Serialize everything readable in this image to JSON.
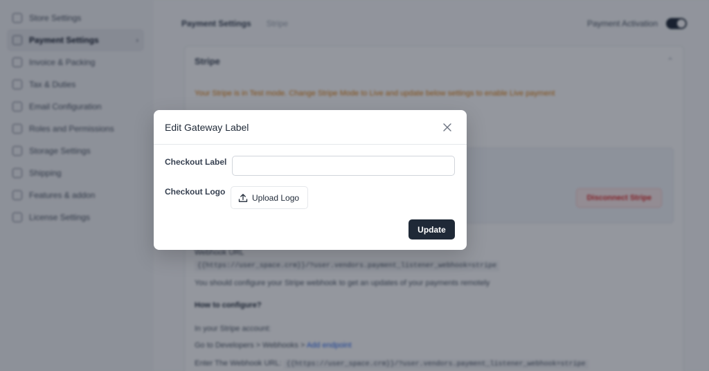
{
  "sidebar": {
    "items": [
      {
        "label": "Store Settings",
        "icon": "store-icon"
      },
      {
        "label": "Payment Settings",
        "icon": "payment-icon",
        "active": true
      },
      {
        "label": "Invoice & Packing",
        "icon": "invoice-icon"
      },
      {
        "label": "Tax & Duties",
        "icon": "tax-icon"
      },
      {
        "label": "Email Configuration",
        "icon": "email-icon"
      },
      {
        "label": "Roles and Permissions",
        "icon": "roles-icon"
      },
      {
        "label": "Storage Settings",
        "icon": "storage-icon"
      },
      {
        "label": "Shipping",
        "icon": "shipping-icon"
      },
      {
        "label": "Features & addon",
        "icon": "features-icon"
      },
      {
        "label": "License Settings",
        "icon": "license-icon"
      }
    ]
  },
  "header": {
    "breadcrumb_main": "Payment Settings",
    "breadcrumb_sub": "Stripe",
    "toggle_label": "Payment Activation"
  },
  "card": {
    "title": "Stripe",
    "warning": "Your Stripe is in Test mode. Change Stripe Mode to Live and update below settings to enable Live payment",
    "disconnect_label": "Disconnect Stripe",
    "webhook_heading": "Webhook URL",
    "webhook_url": "{{https://user_space.crm}}/?user.vendors.payment_listener_webhook=stripe",
    "paragraph": "You should configure your Stripe webhook to get an updates of your payments remotely",
    "howto": "How to configure?",
    "step1": "In your Stripe account:",
    "step2_prefix": "Go to Developers > Webhooks > ",
    "step2_link": "Add endpoint",
    "step3_prefix": "Enter The Webhook URL: ",
    "step3_code": "{{https://user_space.crm}}/?user.vendors.payment_listener_webhook=stripe"
  },
  "modal": {
    "title": "Edit Gateway Label",
    "checkout_label": "Checkout Label",
    "checkout_label_value": "",
    "checkout_logo": "Checkout Logo",
    "upload_label": "Upload Logo",
    "update_label": "Update"
  },
  "colors": {
    "primary": "#1f2937",
    "warning": "#d97706",
    "danger": "#dc2626",
    "link": "#2563eb"
  }
}
